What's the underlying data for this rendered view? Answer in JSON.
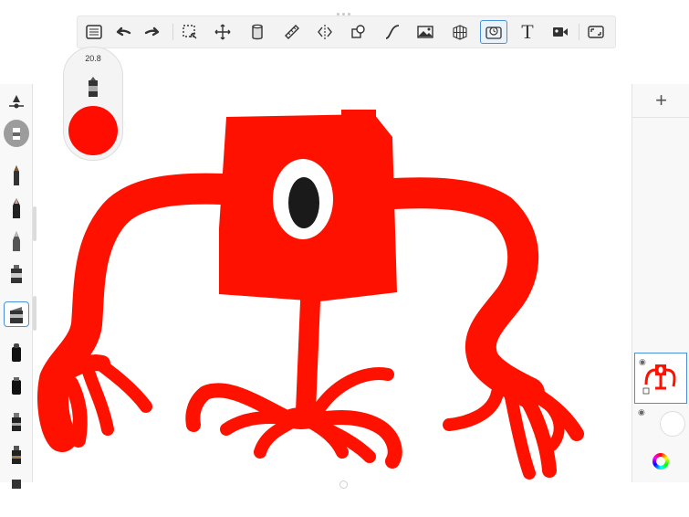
{
  "toolbar": {
    "tools": [
      "list-icon",
      "undo-icon",
      "redo-icon",
      "selection-icon",
      "transform-icon",
      "fill-icon",
      "ruler-icon",
      "symmetry-icon",
      "shapes-icon",
      "curve-icon",
      "image-import-icon",
      "perspective-grid-icon",
      "time-lapse-icon",
      "text-tool",
      "video-icon",
      "fullscreen-icon"
    ],
    "text_tool_label": "T"
  },
  "brush_puck": {
    "size_value": "20.8",
    "current_color": "#ff0d00"
  },
  "brush_library": {
    "brushes": [
      "brush-settings",
      "airbrush",
      "paint-brush",
      "ink-pen",
      "pencil",
      "marker",
      "chisel-marker",
      "flat-brush",
      "round-brush",
      "soft-eraser",
      "felt-tip",
      "gouache"
    ],
    "selected_index": 6
  },
  "layers": {
    "add_label": "+",
    "items": [
      "layer-1",
      "layer-2"
    ]
  },
  "colors": {
    "paint": "#ff0d00",
    "accent": "#4a90d9",
    "panel": "#f8f8f8"
  }
}
